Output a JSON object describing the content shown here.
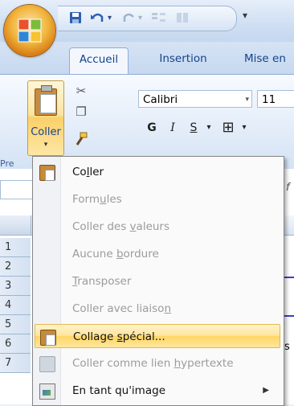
{
  "quick_access": {
    "customize_glyph": "▾"
  },
  "tabs": [
    {
      "label": "Accueil",
      "active": true
    },
    {
      "label": "Insertion",
      "active": false
    },
    {
      "label": "Mise en",
      "active": false
    }
  ],
  "ribbon": {
    "paste_label": "Coller",
    "paste_arrow": "▾",
    "font_name": "Calibri",
    "font_size": "11",
    "bold": "G",
    "italic": "I",
    "underline": "S",
    "border_glyph": "⊞",
    "group_label_partial": "Pre"
  },
  "formula_bar": {
    "fx": "f"
  },
  "rows": [
    "1",
    "2",
    "3",
    "4",
    "5",
    "6",
    "7"
  ],
  "cells": {
    "row5_partial": "s"
  },
  "menu": {
    "items": [
      {
        "before": "Co",
        "ul": "l",
        "after": "ler",
        "enabled": true,
        "icon": "paste-icon"
      },
      {
        "before": "Form",
        "ul": "u",
        "after": "les",
        "enabled": false,
        "icon": ""
      },
      {
        "before": "Coller des ",
        "ul": "v",
        "after": "aleurs",
        "enabled": false,
        "icon": ""
      },
      {
        "before": "Aucune ",
        "ul": "b",
        "after": "ordure",
        "enabled": false,
        "icon": ""
      },
      {
        "before": "",
        "ul": "T",
        "after": "ransposer",
        "enabled": false,
        "icon": ""
      },
      {
        "before": "Coller avec liaiso",
        "ul": "n",
        "after": "",
        "enabled": false,
        "icon": ""
      },
      {
        "before": "Collage ",
        "ul": "s",
        "after": "pécial...",
        "enabled": true,
        "icon": "paste-special-icon",
        "hover": true
      },
      {
        "before": "Coller comme lien ",
        "ul": "h",
        "after": "ypertexte",
        "enabled": false,
        "icon": "hyperlink-icon"
      },
      {
        "before": "En tant qu'ima",
        "ul": "g",
        "after": "e",
        "enabled": true,
        "icon": "picture-icon",
        "submenu": "▶"
      }
    ]
  }
}
